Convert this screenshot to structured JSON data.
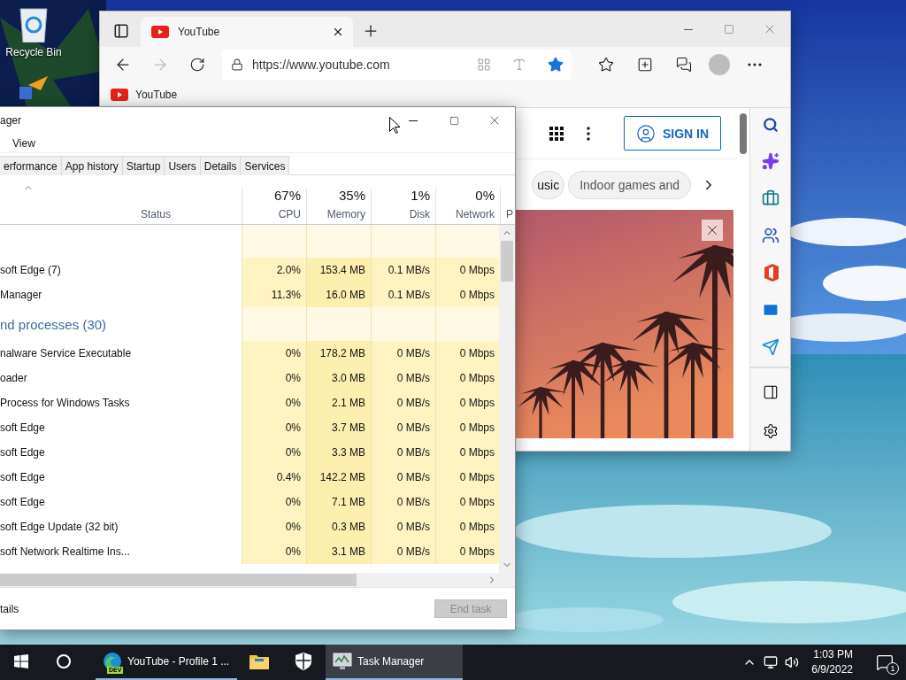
{
  "desktop": {
    "icons": [
      {
        "kind": "recycle",
        "label": "Recycle Bin"
      },
      {
        "kind": "app"
      }
    ]
  },
  "browser": {
    "tabs": [
      {
        "label": "YouTube",
        "selected": true
      }
    ],
    "address": "https://www.youtube.com",
    "favorited": true,
    "favorites": [
      {
        "label": "YouTube"
      }
    ],
    "page": {
      "sign_in": "SIGN IN",
      "chips": [
        {
          "label": "usic"
        },
        {
          "label": "Indoor games and"
        }
      ]
    }
  },
  "task_manager": {
    "title": "ager",
    "menu": [
      {
        "label": "View"
      }
    ],
    "tabs": [
      {
        "label": "erformance",
        "selected": false
      },
      {
        "label": "App history",
        "selected": false
      },
      {
        "label": "Startup",
        "selected": false
      },
      {
        "label": "Users",
        "selected": false
      },
      {
        "label": "Details",
        "selected": false
      },
      {
        "label": "Services",
        "selected": false
      }
    ],
    "columns": [
      {
        "label": "Status"
      },
      {
        "percent": "67%",
        "label": "CPU"
      },
      {
        "percent": "35%",
        "label": "Memory"
      },
      {
        "percent": "1%",
        "label": "Disk"
      },
      {
        "percent": "0%",
        "label": "Network"
      },
      {
        "label": "P"
      }
    ],
    "rows": [
      {
        "kind": "group"
      },
      {
        "kind": "process",
        "name": "soft Edge (7)",
        "cpu": "2.0%",
        "memory": "153.4 MB",
        "disk": "0.1 MB/s",
        "network": "0 Mbps"
      },
      {
        "kind": "process",
        "name": "Manager",
        "cpu": "11.3%",
        "memory": "16.0 MB",
        "disk": "0.1 MB/s",
        "network": "0 Mbps"
      },
      {
        "kind": "group",
        "label": "nd processes (30)"
      },
      {
        "kind": "process",
        "name": "nalware Service Executable",
        "cpu": "0%",
        "memory": "178.2 MB",
        "disk": "0 MB/s",
        "network": "0 Mbps"
      },
      {
        "kind": "process",
        "name": "oader",
        "cpu": "0%",
        "memory": "3.0 MB",
        "disk": "0 MB/s",
        "network": "0 Mbps"
      },
      {
        "kind": "process",
        "name": "Process for Windows Tasks",
        "cpu": "0%",
        "memory": "2.1 MB",
        "disk": "0 MB/s",
        "network": "0 Mbps"
      },
      {
        "kind": "process",
        "name": "soft Edge",
        "cpu": "0%",
        "memory": "3.7 MB",
        "disk": "0 MB/s",
        "network": "0 Mbps"
      },
      {
        "kind": "process",
        "name": "soft Edge",
        "cpu": "0%",
        "memory": "3.3 MB",
        "disk": "0 MB/s",
        "network": "0 Mbps"
      },
      {
        "kind": "process",
        "name": "soft Edge",
        "cpu": "0.4%",
        "memory": "142.2 MB",
        "disk": "0 MB/s",
        "network": "0 Mbps"
      },
      {
        "kind": "process",
        "name": "soft Edge",
        "cpu": "0%",
        "memory": "7.1 MB",
        "disk": "0 MB/s",
        "network": "0 Mbps"
      },
      {
        "kind": "process",
        "name": "soft Edge Update (32 bit)",
        "cpu": "0%",
        "memory": "0.3 MB",
        "disk": "0 MB/s",
        "network": "0 Mbps"
      },
      {
        "kind": "process",
        "name": "soft Network Realtime Ins...",
        "cpu": "0%",
        "memory": "3.1 MB",
        "disk": "0 MB/s",
        "network": "0 Mbps"
      }
    ],
    "details": "tails",
    "end_task": {
      "label": "End task",
      "disabled": true
    }
  },
  "taskbar": {
    "items": [
      {
        "kind": "start",
        "selected": false,
        "running": false
      },
      {
        "kind": "search",
        "selected": false,
        "running": false
      },
      {
        "kind": "edge",
        "label": "YouTube - Profile 1 ...",
        "badge": "DEV",
        "selected": false,
        "running": true
      },
      {
        "kind": "folder",
        "selected": false,
        "running": false
      },
      {
        "kind": "shield",
        "selected": false,
        "running": false
      },
      {
        "kind": "taskmgr",
        "label": "Task Manager",
        "selected": true,
        "running": true
      }
    ],
    "time": "1:03 PM",
    "date": "6/9/2022",
    "notifications": "1"
  }
}
